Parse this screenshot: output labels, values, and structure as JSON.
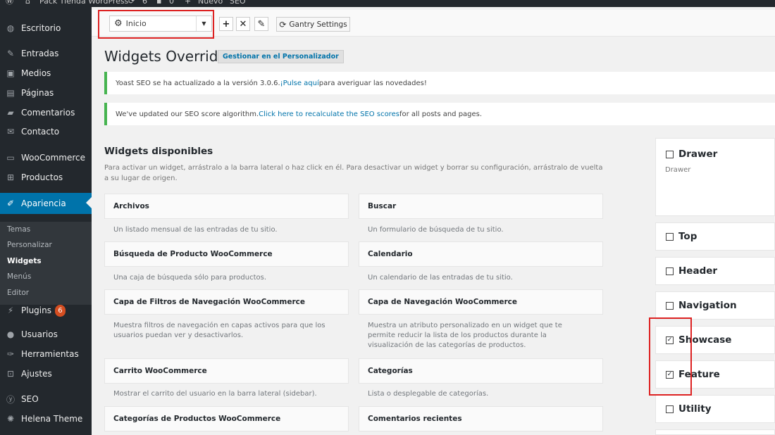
{
  "admin_bar": {
    "site_name": "Pack Tienda WordPress",
    "updates_count": "6",
    "comments_count": "0",
    "new_label": "Nuevo",
    "seo_label": "SEO"
  },
  "sidebar": {
    "items": [
      {
        "label": "Escritorio",
        "icon": "dashboard-icon"
      },
      {
        "label": "Entradas",
        "icon": "pin-icon"
      },
      {
        "label": "Medios",
        "icon": "media-icon"
      },
      {
        "label": "Páginas",
        "icon": "pages-icon"
      },
      {
        "label": "Comentarios",
        "icon": "comments-icon"
      },
      {
        "label": "Contacto",
        "icon": "mail-icon"
      },
      {
        "label": "WooCommerce",
        "icon": "woocommerce-icon"
      },
      {
        "label": "Productos",
        "icon": "cart-icon"
      },
      {
        "label": "Apariencia",
        "icon": "brush-icon"
      },
      {
        "label": "Plugins",
        "icon": "plugin-icon"
      },
      {
        "label": "Usuarios",
        "icon": "user-icon"
      },
      {
        "label": "Herramientas",
        "icon": "wrench-icon"
      },
      {
        "label": "Ajustes",
        "icon": "settings-icon"
      },
      {
        "label": "SEO",
        "icon": "yoast-icon"
      },
      {
        "label": "Helena Theme",
        "icon": "gear-icon"
      }
    ],
    "submenu": [
      "Temas",
      "Personalizar",
      "Widgets",
      "Menús",
      "Editor"
    ],
    "plugins_badge": "6"
  },
  "gantry": {
    "selected_outline": "Inicio",
    "settings_label": "Gantry Settings"
  },
  "header": {
    "title": "Widgets Override",
    "customizer_button": "Gestionar en el Personalizador"
  },
  "notices": {
    "yoast": {
      "before": "Yoast SEO se ha actualizado a la versión 3.0.6. ",
      "link": "¡Pulse aquí",
      "after": " para averiguar las novedades!"
    },
    "seo": {
      "before": "We've updated our SEO score algorithm. ",
      "link": "Click here to recalculate the SEO scores",
      "after": " for all posts and pages."
    }
  },
  "available": {
    "title": "Widgets disponibles",
    "description": "Para activar un widget, arrástralo a la barra lateral o haz click en él. Para desactivar un widget y borrar su configuración, arrástralo de vuelta a su lugar de origen."
  },
  "widgets": [
    {
      "title": "Archivos",
      "desc": "Un listado mensual de las entradas de tu sitio."
    },
    {
      "title": "Buscar",
      "desc": "Un formulario de búsqueda de tu sitio."
    },
    {
      "title": "Búsqueda de Producto WooCommerce",
      "desc": "Una caja de búsqueda sólo para productos."
    },
    {
      "title": "Calendario",
      "desc": "Un calendario de las entradas de tu sitio."
    },
    {
      "title": "Capa de Filtros de Navegación WooCommerce",
      "desc": "Muestra filtros de navegación en capas activos para que los usuarios puedan ver y desactivarlos."
    },
    {
      "title": "Capa de Navegación WooCommerce",
      "desc": "Muestra un atributo personalizado en un widget que te permite reducir la lista de los productos durante la visualización de las categorías de productos."
    },
    {
      "title": "Carrito WooCommerce",
      "desc": "Mostrar el carrito del usuario en la barra lateral (sidebar)."
    },
    {
      "title": "Categorías",
      "desc": "Lista o desplegable de categorías."
    },
    {
      "title": "Categorías de Productos WooCommerce",
      "desc": ""
    },
    {
      "title": "Comentarios recientes",
      "desc": ""
    }
  ],
  "areas": {
    "drawer": {
      "title": "Drawer",
      "sub": "Drawer"
    },
    "list": [
      {
        "title": "Top",
        "checked": ""
      },
      {
        "title": "Header",
        "checked": ""
      },
      {
        "title": "Navigation",
        "checked": ""
      },
      {
        "title": "Showcase",
        "checked": "✓"
      },
      {
        "title": "Feature",
        "checked": "✓"
      },
      {
        "title": "Utility",
        "checked": ""
      }
    ]
  }
}
